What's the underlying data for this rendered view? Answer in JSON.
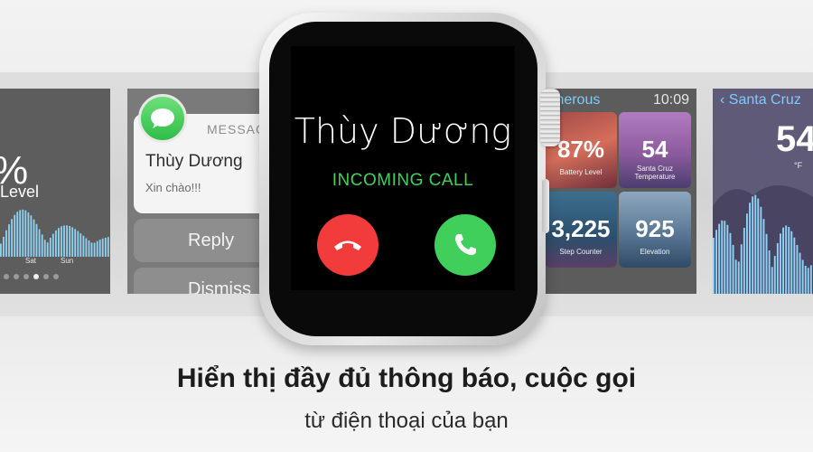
{
  "battery_panel": {
    "percent_fragment": "%",
    "label_fragment": "Level",
    "days": [
      "Sat",
      "Sun"
    ],
    "page_dot_count": 6,
    "active_dot_index": 3
  },
  "message_panel": {
    "app_label": "MESSAG",
    "sender": "Thùy Dương",
    "text": "Xin chào!!!",
    "reply_label": "Reply",
    "dismiss_label": "Dismiss"
  },
  "watch": {
    "caller_name": "Thùy Dương",
    "status": "INCOMING CALL",
    "decline_icon": "phone-hangup-icon",
    "accept_icon": "phone-icon"
  },
  "weather_panel": {
    "title_fragment": "merous",
    "time": "10:09",
    "tiles": [
      {
        "value": "87%",
        "label": "Battery Level"
      },
      {
        "value": "54",
        "label": "Santa Cruz\nTemperature"
      },
      {
        "value": "3,225",
        "label": "Step Counter"
      },
      {
        "value": "925",
        "label": "Elevation"
      }
    ]
  },
  "santa_panel": {
    "title": "Santa Cruz",
    "temperature_fragment": "54",
    "unit": "°F"
  },
  "caption": {
    "headline": "Hiển thị đầy đủ thông báo, cuộc gọi",
    "subline": "từ điện thoại của bạn"
  },
  "colors": {
    "decline": "#f23b3b",
    "accept": "#3fcf5a",
    "status_text": "#3ed25a",
    "link_blue": "#7ecbff"
  }
}
